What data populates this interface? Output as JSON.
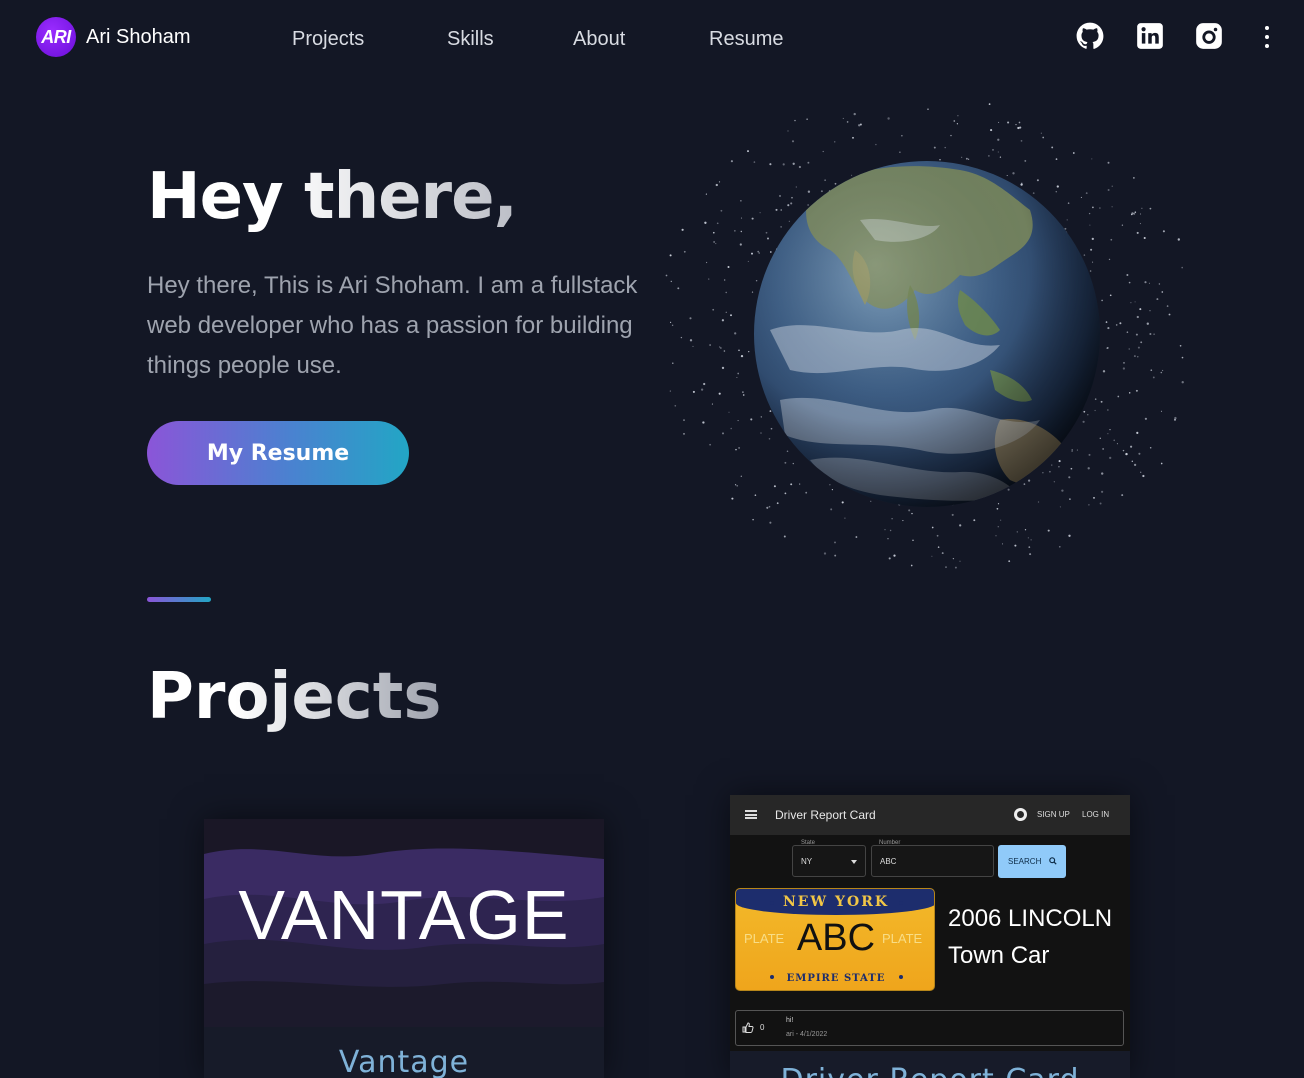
{
  "brand": {
    "logo_text": "ARI",
    "name": "Ari Shoham"
  },
  "nav": {
    "links": [
      {
        "label": "Projects"
      },
      {
        "label": "Skills"
      },
      {
        "label": "About"
      },
      {
        "label": "Resume"
      }
    ],
    "social_icons": [
      "github-icon",
      "linkedin-icon",
      "instagram-icon"
    ],
    "menu_icon": "more-vertical-icon"
  },
  "hero": {
    "title": "Hey there,",
    "description": "Hey there, This is Ari Shoham. I am a fullstack web developer who has a passion for building things people use.",
    "button_label": "My Resume"
  },
  "projects": {
    "title": "Projects",
    "cards": [
      {
        "image_text": "VANTAGE",
        "label": "Vantage"
      },
      {
        "label": "Driver Report Card",
        "screenshot": {
          "app_title": "Driver Report Card",
          "nav_signup": "SIGN UP",
          "nav_login": "LOG IN",
          "state_label": "State",
          "state_value": "NY",
          "number_label": "Number",
          "number_value": "ABC",
          "search_label": "SEARCH",
          "plate_state": "NEW YORK",
          "plate_number": "ABC",
          "plate_side_left": "PLATE",
          "plate_side_right": "PLATE",
          "plate_bottom": "EMPIRE STATE",
          "car_line1": "2006 LINCOLN",
          "car_line2": "Town Car",
          "likes": "0",
          "comment": "hi!",
          "comment_meta": "ari - 4/1/2022"
        }
      }
    ]
  },
  "colors": {
    "background": "#131725",
    "gradient_start": "#8b55d8",
    "gradient_end": "#22a6c5",
    "card_label": "#7fb2d8",
    "logo": "#7a1cf0"
  }
}
